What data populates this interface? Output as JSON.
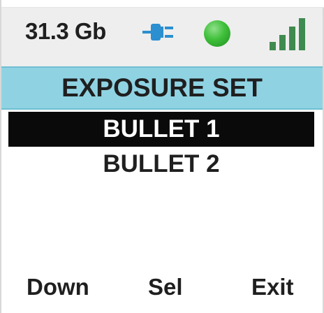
{
  "status_bar": {
    "storage": "31.3 Gb",
    "power_icon": "plug-icon",
    "status_icon": "status-dot",
    "status_color": "#3fbf3a",
    "signal_icon": "signal-bars-icon",
    "signal_bars_filled": 4
  },
  "title": "EXPOSURE SET",
  "menu": {
    "items": [
      {
        "label": "BULLET 1",
        "selected": true
      },
      {
        "label": "BULLET 2",
        "selected": false
      }
    ]
  },
  "softkeys": {
    "left": "Down",
    "middle": "Sel",
    "right": "Exit"
  },
  "colors": {
    "title_bg": "#8fd3e3",
    "selection_bg": "#0a0a0a",
    "signal": "#3f8a4f"
  }
}
